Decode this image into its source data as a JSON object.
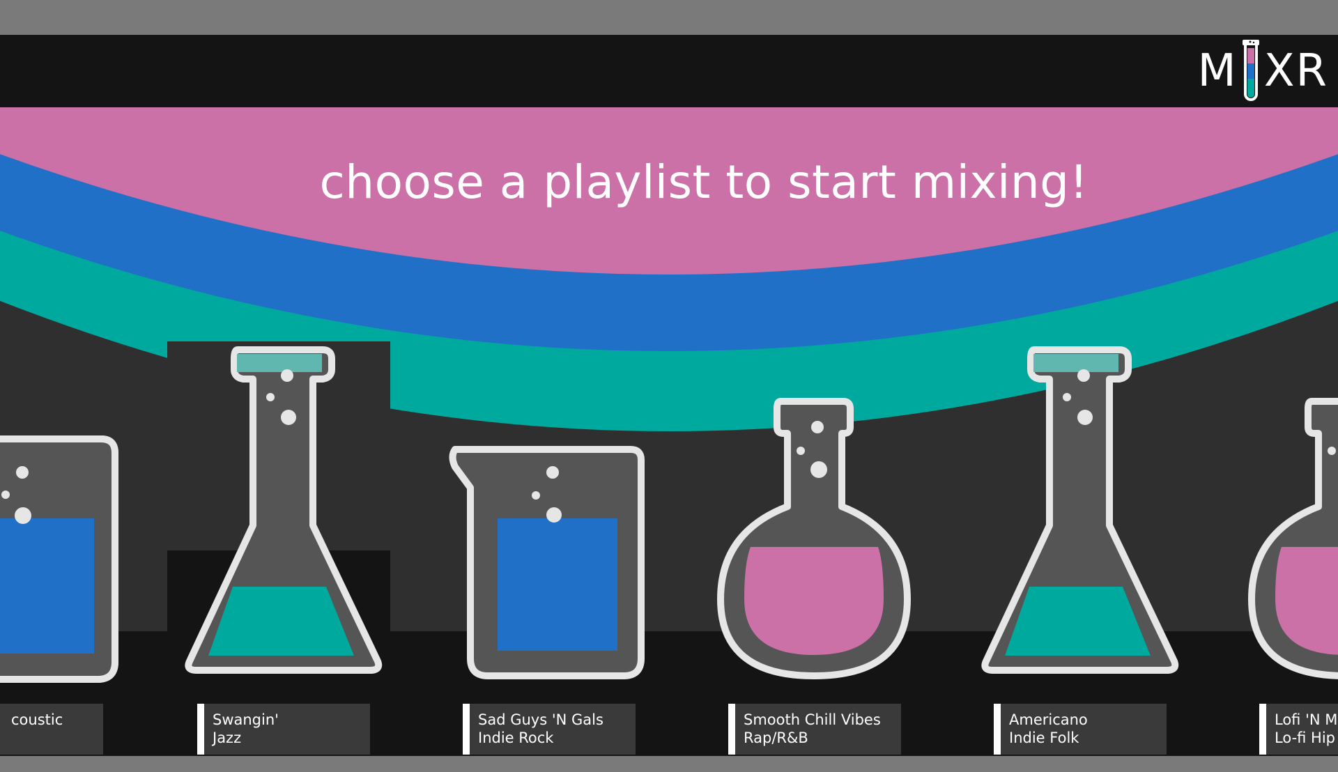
{
  "app": {
    "logo_left": "M",
    "logo_right": "XR"
  },
  "headline": "choose a playlist to start mixing!",
  "colors": {
    "pink": "#cc70a8",
    "blue": "#2170c8",
    "teal": "#00a99e",
    "background": "#2f2f2f",
    "topbar": "#141414"
  },
  "playlists": [
    {
      "name": "",
      "genre": "coustic",
      "vessel": "beaker-icon",
      "liquid": "blue"
    },
    {
      "name": "Swangin'",
      "genre": "Jazz",
      "vessel": "erlenmeyer-flask-icon",
      "liquid": "teal"
    },
    {
      "name": "Sad Guys 'N Gals",
      "genre": "Indie Rock",
      "vessel": "beaker-icon",
      "liquid": "blue"
    },
    {
      "name": "Smooth Chill Vibes",
      "genre": "Rap/R&B",
      "vessel": "round-flask-icon",
      "liquid": "pink"
    },
    {
      "name": "Americano",
      "genre": "Indie Folk",
      "vessel": "erlenmeyer-flask-icon",
      "liquid": "teal"
    },
    {
      "name": "Lofi 'N M",
      "genre": "Lo-fi Hip",
      "vessel": "round-flask-icon",
      "liquid": "pink"
    }
  ]
}
